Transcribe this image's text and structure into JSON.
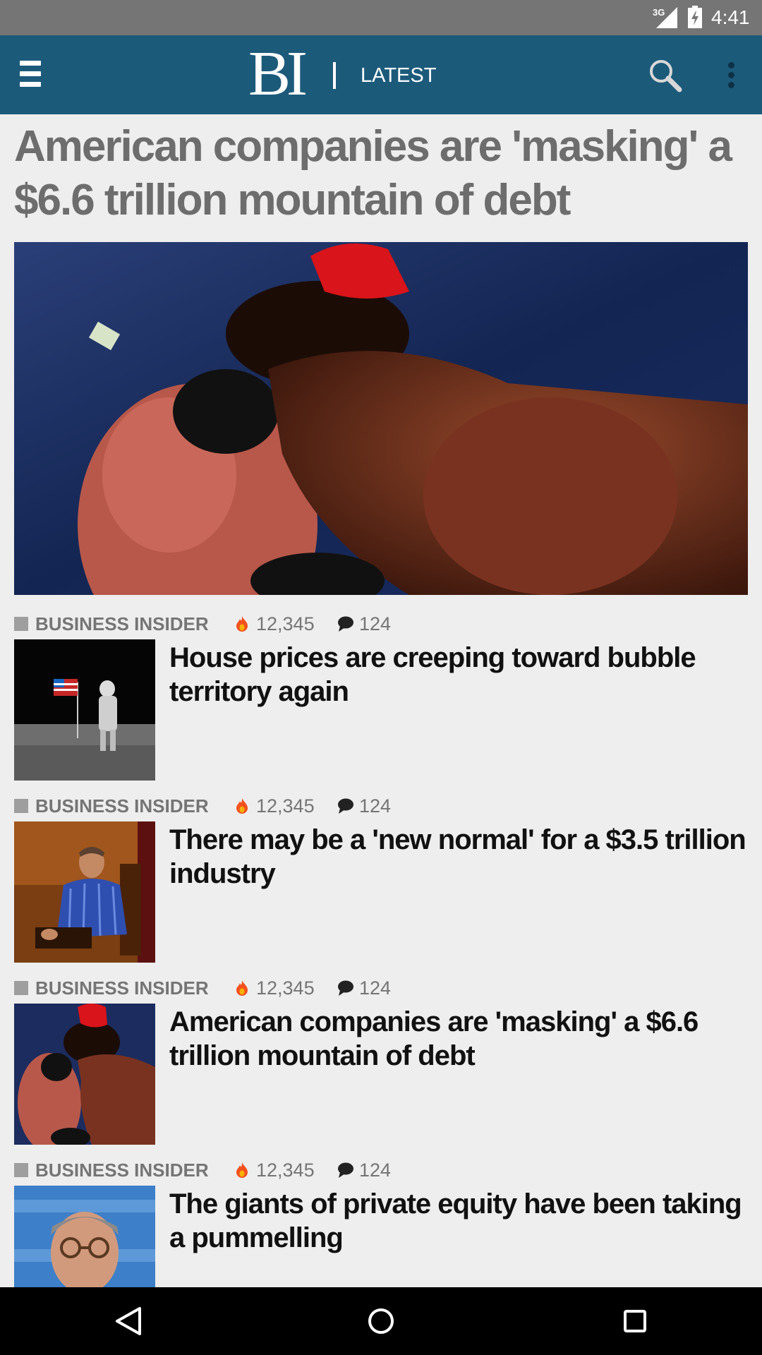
{
  "status_bar": {
    "network": "3G",
    "time": "4:41"
  },
  "app_bar": {
    "logo": "BI",
    "section": "LATEST"
  },
  "hero": {
    "title": "American companies are 'masking' a $6.6 trillion mountain of debt"
  },
  "articles": [
    {
      "source": "BUSINESS INSIDER",
      "views": "12,345",
      "comments": "124",
      "title": "House prices are creeping toward bubble territory again",
      "thumb_icon": "moon-landing-photo"
    },
    {
      "source": "BUSINESS INSIDER",
      "views": "12,345",
      "comments": "124",
      "title": "There may be a 'new normal' for a $3.5 trillion industry",
      "thumb_icon": "seated-man-photo"
    },
    {
      "source": "BUSINESS INSIDER",
      "views": "12,345",
      "comments": "124",
      "title": "American companies are 'masking' a $6.6 trillion mountain of debt",
      "thumb_icon": "boxing-photo"
    },
    {
      "source": "BUSINESS INSIDER",
      "views": "12,345",
      "comments": "124",
      "title": "The giants of private equity have been taking a pummelling",
      "thumb_icon": "man-with-glasses-photo"
    }
  ],
  "colors": {
    "app_bar": "#1c5a7a",
    "background": "#eeeeee",
    "flame": "#f4511e"
  }
}
